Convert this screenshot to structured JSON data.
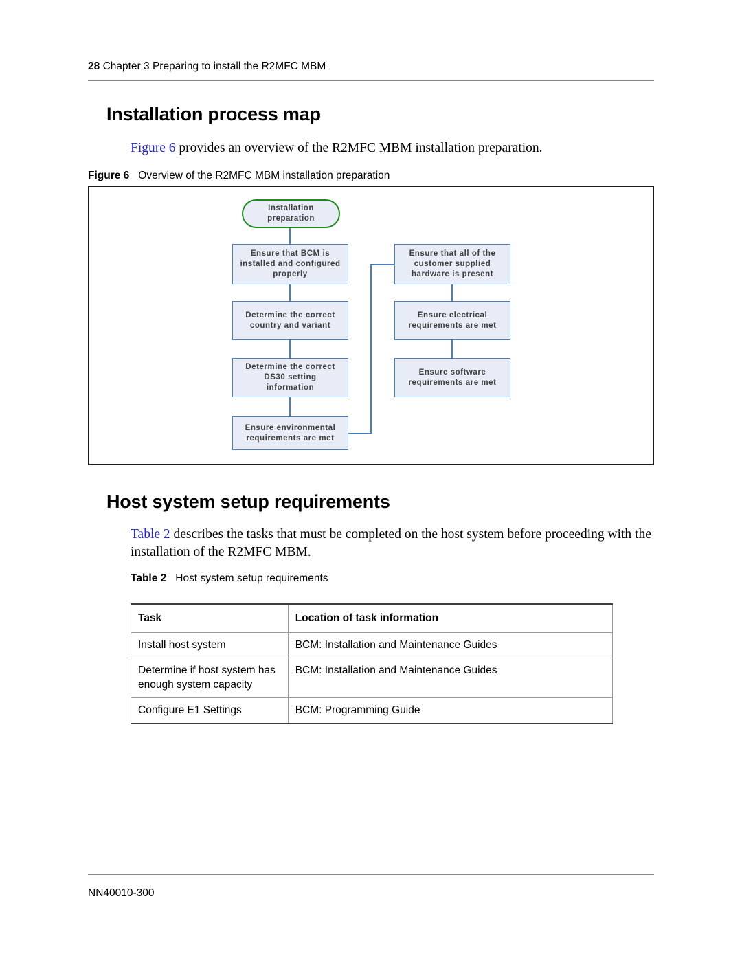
{
  "page": {
    "header": {
      "folio": "28",
      "chapter": "Chapter 3 Preparing to install the R2MFC MBM"
    },
    "footer": {
      "doc_number": "NN40010-300"
    }
  },
  "sections": [
    {
      "heading": "Installation process map",
      "intro_xref": "Figure 6",
      "intro_rest": " provides an overview of the R2MFC MBM installation preparation."
    },
    {
      "heading": "Host system setup requirements",
      "intro_xref": "Table 2",
      "intro_rest": " describes the tasks that must be completed on the host system before proceeding with the installation of the R2MFC MBM."
    }
  ],
  "figure": {
    "caption_label": "Figure 6",
    "caption_text": "Overview of the R2MFC MBM installation preparation",
    "colors": {
      "start_border": "#1d8a1d",
      "node_border": "#4a7ebb",
      "node_fill": "#e7ecf6",
      "node_text": "#3d3d3d",
      "frame_border": "#1c1c1c"
    },
    "nodes": {
      "start": "Installation\npreparation",
      "left_1": "Ensure that BCM is\ninstalled and configured\nproperly",
      "left_2": "Determine  the  correct\ncountry and variant",
      "left_3": "Determine  the  correct\nDS30 setting\ninformation",
      "left_4": "Ensure  environmental\nrequirements   are   met",
      "right_1": "Ensure that all of the\ncustomer  supplied\nhardware  is  present",
      "right_2": "Ensure electrical\nrequirements  are  met",
      "right_3": "Ensure   software\nrequirements  are  met"
    }
  },
  "table": {
    "caption_label": "Table 2",
    "caption_text": "Host system setup requirements",
    "columns": [
      "Task",
      "Location of task information"
    ],
    "rows": [
      [
        "Install host system",
        "BCM: Installation and Maintenance Guides"
      ],
      [
        "Determine if host system has enough system capacity",
        "BCM: Installation and Maintenance Guides"
      ],
      [
        "Configure E1 Settings",
        "BCM: Programming Guide"
      ]
    ]
  }
}
